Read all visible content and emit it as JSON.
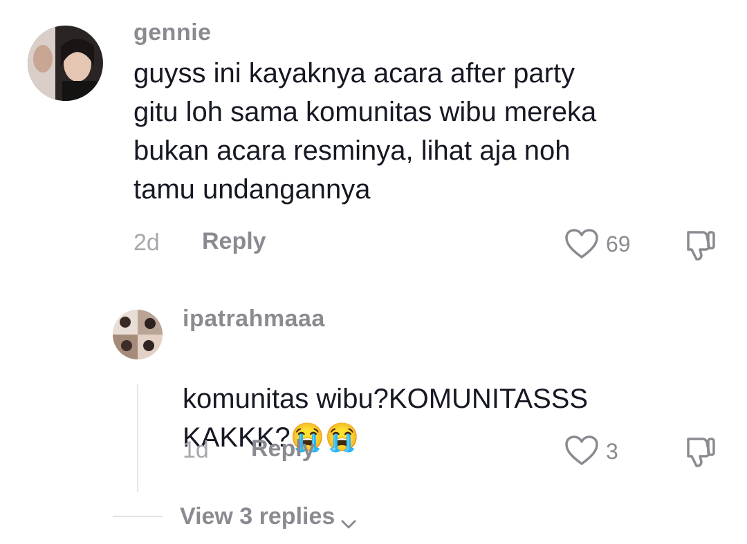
{
  "comments": [
    {
      "username": "gennie",
      "text": "guyss ini kayaknya acara after party\ngitu loh sama komunitas wibu mereka\nbukan acara resminya, lihat aja noh\ntamu undangannya",
      "time": "2d",
      "reply_label": "Reply",
      "likes": "69"
    },
    {
      "username": "ipatrahmaaa",
      "text": "komunitas wibu?KOMUNITASSS\nKAKKK?",
      "emojis": [
        "😭",
        "😭"
      ],
      "time": "1d",
      "reply_label": "Reply",
      "likes": "3"
    }
  ],
  "view_replies_label": "View 3 replies",
  "icons": {
    "like": "heart-outline-icon",
    "dislike": "thumbs-down-icon",
    "expand": "chevron-down-icon"
  }
}
